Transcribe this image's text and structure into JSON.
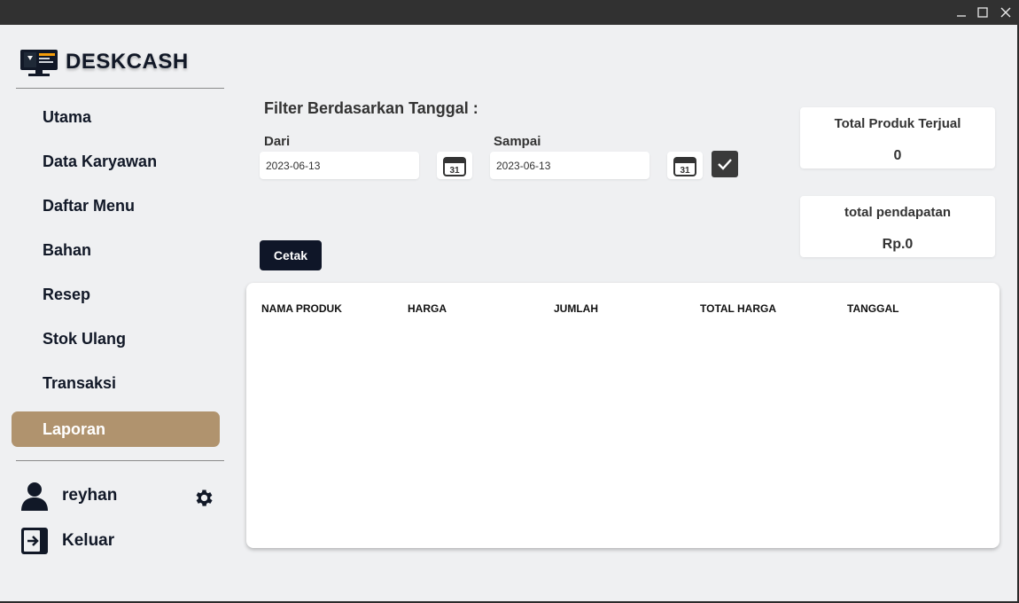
{
  "window": {
    "controls": {
      "minimize": "—",
      "maximize": "☐",
      "close": "✕"
    }
  },
  "brand": {
    "name": "DESKCASH",
    "icon": "cash-register-monitor-icon"
  },
  "sidebar": {
    "items": [
      {
        "label": "Utama",
        "active": false
      },
      {
        "label": "Data Karyawan",
        "active": false
      },
      {
        "label": "Daftar Menu",
        "active": false
      },
      {
        "label": "Bahan",
        "active": false
      },
      {
        "label": "Resep",
        "active": false
      },
      {
        "label": "Stok Ulang",
        "active": false
      },
      {
        "label": "Transaksi",
        "active": false
      },
      {
        "label": "Laporan",
        "active": true
      }
    ],
    "active_color": "#b0936e",
    "user": {
      "name": "reyhan",
      "settings_icon": "gear-icon",
      "avatar_icon": "user-icon"
    },
    "logout": {
      "label": "Keluar",
      "icon": "logout-icon"
    }
  },
  "filter": {
    "title": "Filter Berdasarkan Tanggal :",
    "from": {
      "label": "Dari",
      "value": "2023-06-13"
    },
    "to": {
      "label": "Sampai",
      "value": "2023-06-13"
    },
    "calendar_icon_text": "31"
  },
  "actions": {
    "print_label": "Cetak"
  },
  "stats": {
    "total_sold": {
      "label": "Total Produk Terjual",
      "value": "0"
    },
    "total_income": {
      "label": "total pendapatan",
      "value": "Rp.0"
    }
  },
  "table": {
    "columns": [
      "NAMA PRODUK",
      "HARGA",
      "JUMLAH",
      "TOTAL HARGA",
      "TANGGAL"
    ],
    "rows": []
  }
}
